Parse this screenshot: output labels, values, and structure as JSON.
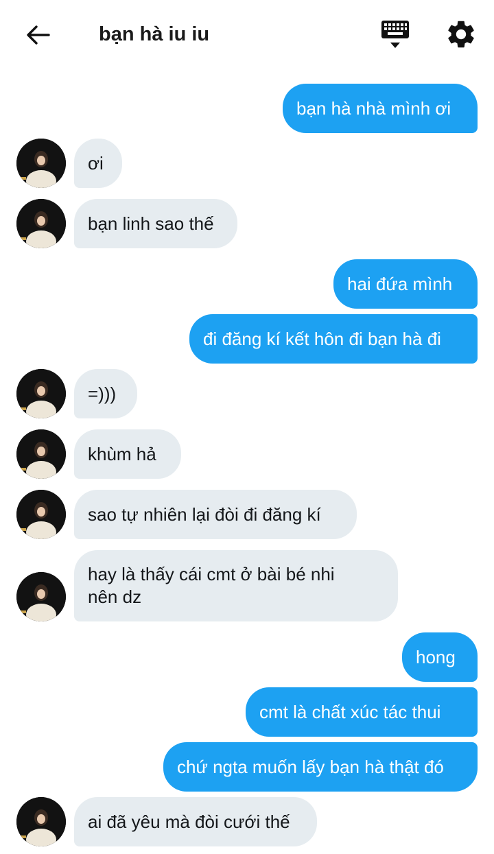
{
  "header": {
    "title": "bạn hà iu iu",
    "back_icon": "arrow-left-icon",
    "keyboard_icon": "keyboard-icon",
    "settings_icon": "gear-icon"
  },
  "colors": {
    "outgoing_bubble": "#1da1f2",
    "incoming_bubble": "#e6ecf0"
  },
  "messages": [
    {
      "dir": "out",
      "text": "bạn hà nhà mình ơi"
    },
    {
      "dir": "in",
      "text": "ơi"
    },
    {
      "dir": "in",
      "text": "bạn linh sao thế"
    },
    {
      "dir": "out",
      "text": "hai đứa mình"
    },
    {
      "dir": "out",
      "text": "đi đăng kí kết hôn đi bạn hà đi"
    },
    {
      "dir": "in",
      "text": "=)))"
    },
    {
      "dir": "in",
      "text": "khùm hả"
    },
    {
      "dir": "in",
      "text": "sao tự nhiên lại đòi đi đăng kí"
    },
    {
      "dir": "in",
      "text_lines": [
        "hay là thấy cái cmt ở bài bé nhi",
        "nên dz"
      ]
    },
    {
      "dir": "out",
      "text": "hong"
    },
    {
      "dir": "out",
      "text": "cmt là chất xúc tác thui"
    },
    {
      "dir": "out",
      "text": "chứ ngta muốn lấy bạn hà thật đó"
    },
    {
      "dir": "in",
      "text": "ai đã yêu mà đòi cưới thế"
    }
  ]
}
